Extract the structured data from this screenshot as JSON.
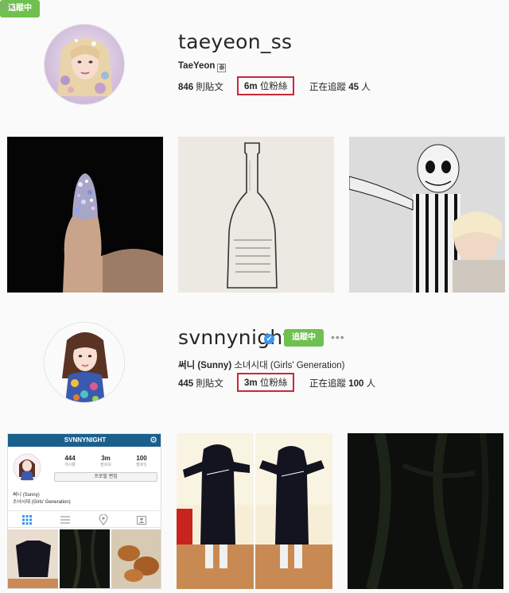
{
  "profiles": [
    {
      "username": "taeyeon_ss",
      "verified_mark": "✔",
      "follow_label": "追蹤中",
      "more": "•••",
      "fullname": "TaeYeon",
      "fullname_rest": "",
      "name_badge": "泰",
      "posts_count": "846",
      "posts_label": "則貼文",
      "followers_count": "6m",
      "followers_label": "位粉絲",
      "following_label": "正在追蹤",
      "following_count": "45",
      "following_unit": "人"
    },
    {
      "username": "svnnynight",
      "verified_mark": "✔",
      "follow_label": "追蹤中",
      "more": "•••",
      "fullname": "써니 (Sunny)",
      "fullname_rest": " 소녀시대 (Girls' Generation)",
      "posts_count": "445",
      "posts_label": "則貼文",
      "followers_count": "3m",
      "followers_label": "位粉絲",
      "following_label": "正在追蹤",
      "following_count": "100",
      "following_unit": "人"
    }
  ],
  "phone_screenshot": {
    "title": "SVNNYNIGHT",
    "settings_icon": "gear-icon",
    "stats": [
      {
        "value": "444",
        "label": "게시물"
      },
      {
        "value": "3m",
        "label": "팔로워"
      },
      {
        "value": "100",
        "label": "팔로잉"
      }
    ],
    "edit_profile": "프로필 편집",
    "name": "써니 (Sunny)",
    "bio": "소녀시대 (Girls' Generation)",
    "tab_icons": [
      "grid-icon",
      "list-icon",
      "location-pin-icon",
      "tagged-person-icon"
    ]
  },
  "colors": {
    "verified": "#3897f0",
    "follow_button": "#70c050",
    "highlight_box": "#c8283c",
    "phone_header": "#1b5f8c"
  }
}
